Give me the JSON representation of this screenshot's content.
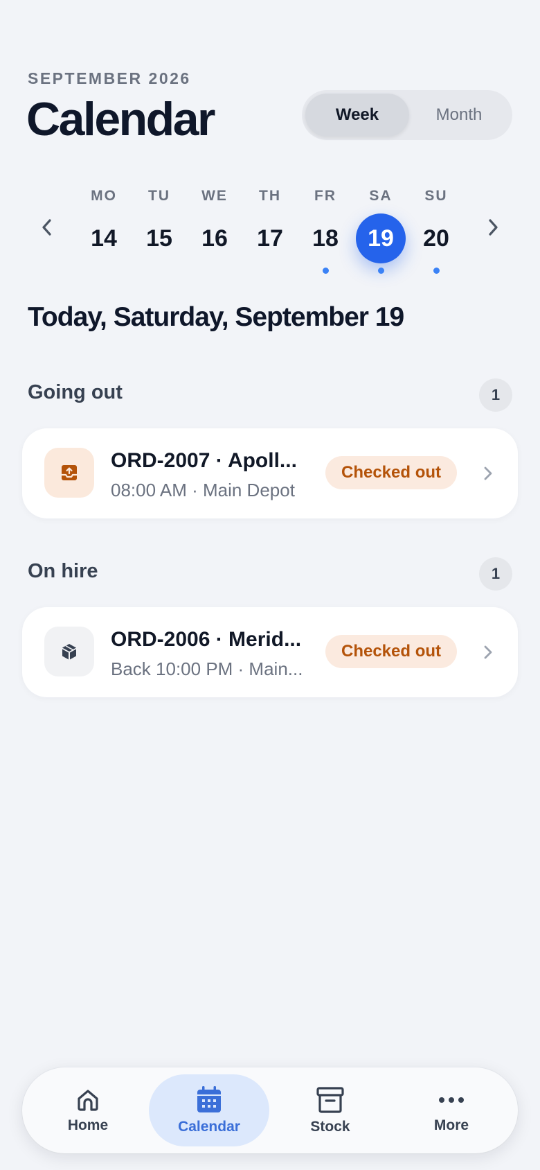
{
  "header": {
    "eyebrow": "SEPTEMBER 2026",
    "title": "Calendar",
    "view_toggle": {
      "week": "Week",
      "month": "Month",
      "selected": "Week"
    }
  },
  "week": {
    "days": [
      {
        "label": "MO",
        "num": "14",
        "has_event": false,
        "selected": false
      },
      {
        "label": "TU",
        "num": "15",
        "has_event": false,
        "selected": false
      },
      {
        "label": "WE",
        "num": "16",
        "has_event": false,
        "selected": false
      },
      {
        "label": "TH",
        "num": "17",
        "has_event": false,
        "selected": false
      },
      {
        "label": "FR",
        "num": "18",
        "has_event": true,
        "selected": false
      },
      {
        "label": "SA",
        "num": "19",
        "has_event": true,
        "selected": true
      },
      {
        "label": "SU",
        "num": "20",
        "has_event": true,
        "selected": false
      }
    ]
  },
  "date_heading": "Today, Saturday, September 19",
  "sections": {
    "going_out": {
      "title": "Going out",
      "count": "1",
      "card": {
        "title": "ORD-2007 · Apoll...",
        "subtitle": "08:00 AM · Main Depot",
        "status": "Checked out",
        "icon": "tray-upload-icon"
      }
    },
    "on_hire": {
      "title": "On hire",
      "count": "1",
      "card": {
        "title": "ORD-2006 · Merid...",
        "subtitle": "Back 10:00 PM · Main...",
        "status": "Checked out",
        "icon": "box-icon"
      }
    }
  },
  "nav": {
    "home": "Home",
    "calendar": "Calendar",
    "stock": "Stock",
    "more": "More",
    "active": "Calendar"
  },
  "colors": {
    "accent": "#2563eb",
    "status_bg": "#fbeadf",
    "status_text": "#b45309"
  }
}
